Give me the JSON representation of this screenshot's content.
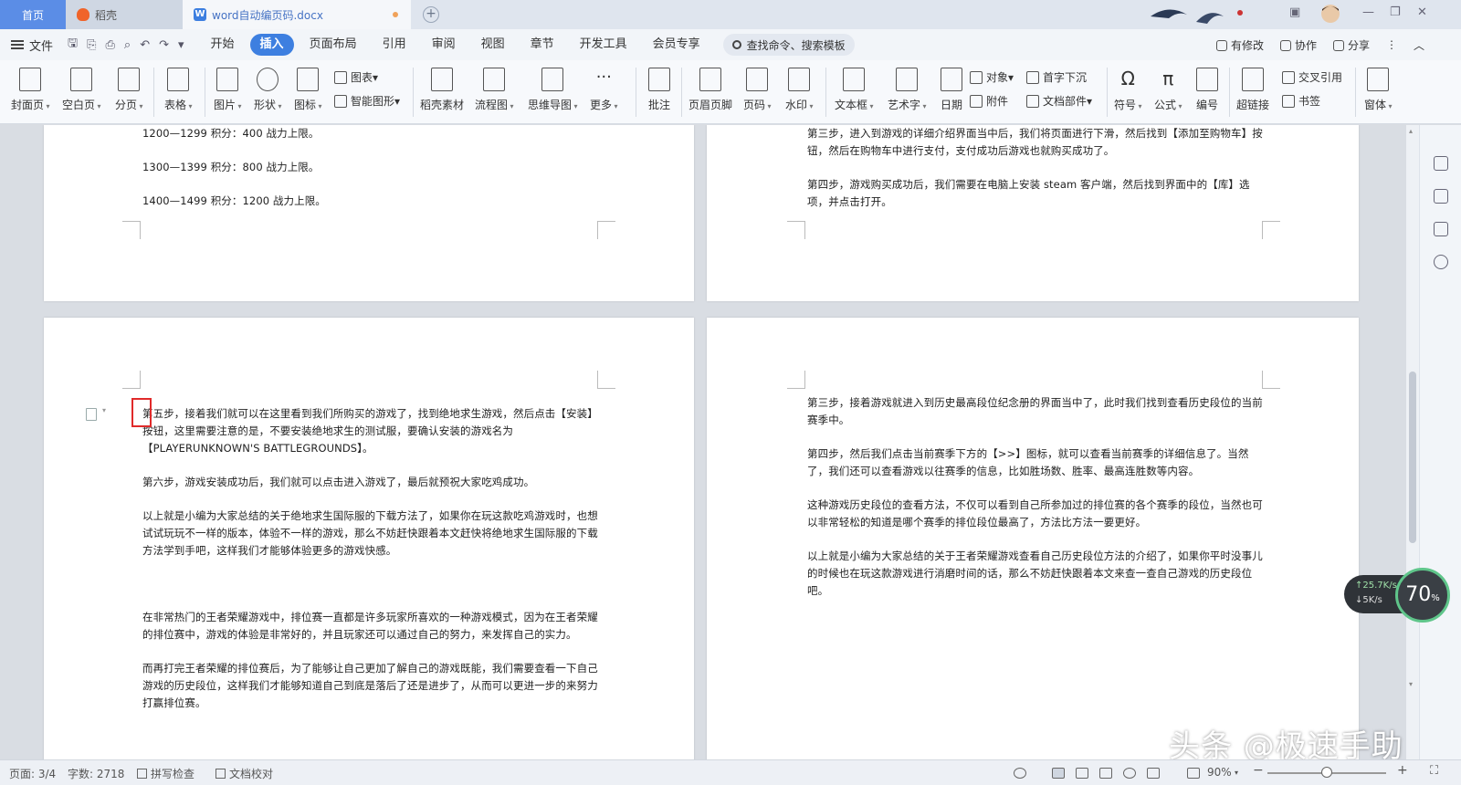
{
  "tabs": {
    "home": "首页",
    "daoke": "稻壳",
    "doc": "word自动编页码.docx"
  },
  "menubar": {
    "file": "文件",
    "tabs": [
      "开始",
      "插入",
      "页面布局",
      "引用",
      "审阅",
      "视图",
      "章节",
      "开发工具",
      "会员专享"
    ],
    "active_tab": "插入",
    "search": "查找命令、搜索模板",
    "has_changes": "有修改",
    "collaborate": "协作",
    "share": "分享"
  },
  "ribbon": {
    "cover": "封面页",
    "blank": "空白页",
    "pagebreak": "分页",
    "table": "表格",
    "picture": "图片",
    "shape": "形状",
    "icon": "图标",
    "chart": "图表",
    "smartart": "智能图形",
    "daoke_material": "稻壳素材",
    "flowchart": "流程图",
    "mindmap": "思维导图",
    "more": "更多",
    "comment": "批注",
    "header_footer": "页眉页脚",
    "page_number": "页码",
    "watermark": "水印",
    "textbox": "文本框",
    "wordart": "艺术字",
    "date": "日期",
    "object": "对象",
    "attachment": "附件",
    "drop_cap": "首字下沉",
    "doc_parts": "文档部件",
    "symbol": "符号",
    "formula": "公式",
    "numbering": "编号",
    "hyperlink": "超链接",
    "cross_ref": "交叉引用",
    "bookmark": "书签",
    "window": "窗体"
  },
  "pages": {
    "top_left": [
      "1200—1299 积分：400 战力上限。",
      "1300—1399 积分：800 战力上限。",
      "1400—1499 积分：1200 战力上限。"
    ],
    "top_right": [
      "第三步，进入到游戏的详细介绍界面当中后，我们将页面进行下滑，然后找到【添加至购物车】按钮，然后在购物车中进行支付，支付成功后游戏也就购买成功了。",
      "第四步，游戏购买成功后，我们需要在电脑上安装 steam 客户端，然后找到界面中的【库】选项，并点击打开。"
    ],
    "bottom_left": [
      "第五步，接着我们就可以在这里看到我们所购买的游戏了，找到绝地求生游戏，然后点击【安装】按钮，这里需要注意的是，不要安装绝地求生的测试服，要确认安装的游戏名为【PLAYERUNKNOWN'S BATTLEGROUNDS】。",
      "第六步，游戏安装成功后，我们就可以点击进入游戏了，最后就预祝大家吃鸡成功。",
      "以上就是小编为大家总结的关于绝地求生国际服的下载方法了，如果你在玩这款吃鸡游戏时，也想试试玩玩不一样的版本，体验不一样的游戏，那么不妨赶快跟着本文赶快将绝地求生国际服的下载方法学到手吧，这样我们才能够体验更多的游戏快感。",
      "在非常热门的王者荣耀游戏中，排位赛一直都是许多玩家所喜欢的一种游戏模式，因为在王者荣耀的排位赛中，游戏的体验是非常好的，并且玩家还可以通过自己的努力，来发挥自己的实力。",
      "而再打完王者荣耀的排位赛后，为了能够让自己更加了解自己的游戏既能，我们需要查看一下自己游戏的历史段位，这样我们才能够知道自己到底是落后了还是进步了，从而可以更进一步的来努力打赢排位赛。"
    ],
    "bottom_right": [
      "第三步，接着游戏就进入到历史最高段位纪念册的界面当中了，此时我们找到查看历史段位的当前赛季中。",
      "第四步，然后我们点击当前赛季下方的【>>】图标，就可以查看当前赛季的详细信息了。当然了，我们还可以查看游戏以往赛季的信息，比如胜场数、胜率、最高连胜数等内容。",
      "这种游戏历史段位的查看方法，不仅可以看到自己所参加过的排位赛的各个赛季的段位，当然也可以非常轻松的知道是哪个赛季的排位段位最高了，方法比方法一要更好。",
      "以上就是小编为大家总结的关于王者荣耀游戏查看自己历史段位方法的介绍了，如果你平时没事儿的时候也在玩这款游戏进行消磨时间的话，那么不妨赶快跟着本文来查一查自己游戏的历史段位吧。"
    ]
  },
  "net_widget": {
    "up": "25.7K/s",
    "down": "5K/s",
    "percent": "70",
    "percent_unit": "%"
  },
  "statusbar": {
    "page": "页面: 3/4",
    "wordcount": "字数: 2718",
    "spellcheck": "拼写检查",
    "proofread": "文档校对",
    "zoom": "90%",
    "zoom_fraction": 0.5
  },
  "watermark": "头条 @极速手助"
}
